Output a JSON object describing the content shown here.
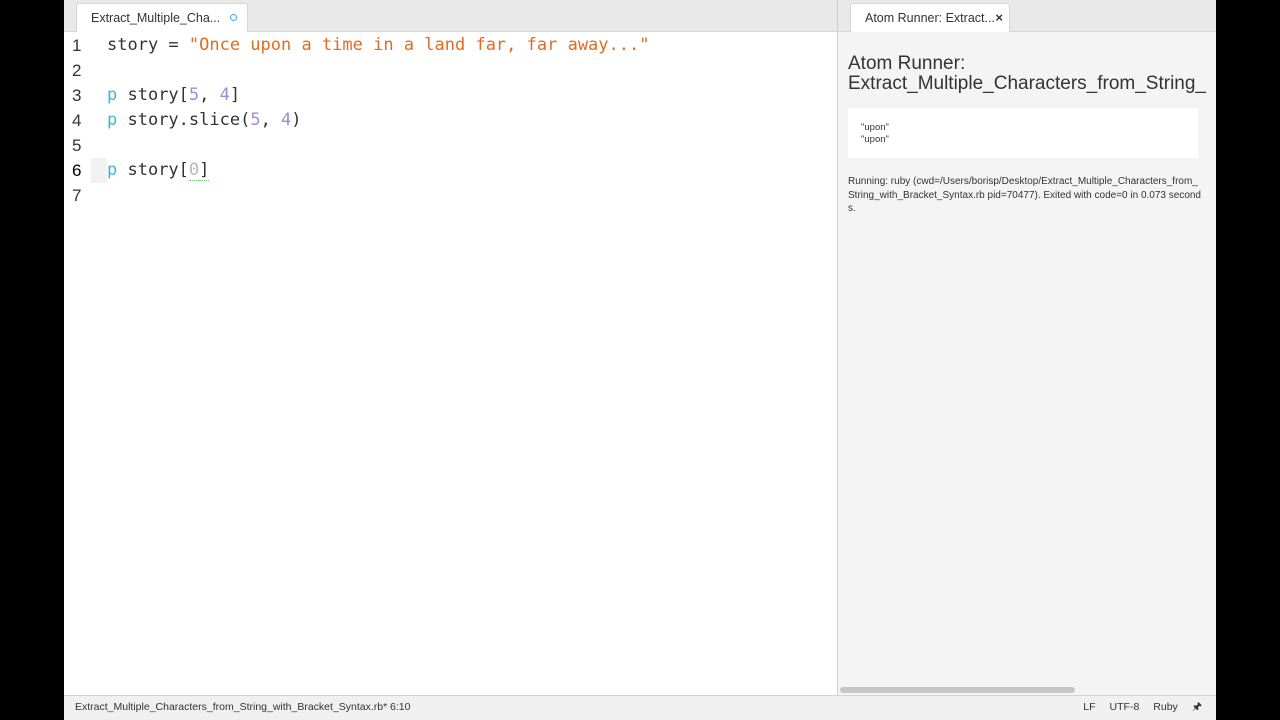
{
  "editor": {
    "tab_label": "Extract_Multiple_Cha...",
    "lines": [
      {
        "num": "1",
        "tokens": [
          {
            "t": "story = ",
            "c": "ident"
          },
          {
            "t": "\"Once upon a time in a land far, far away...\"",
            "c": "string"
          }
        ]
      },
      {
        "num": "2",
        "tokens": []
      },
      {
        "num": "3",
        "tokens": [
          {
            "t": "p",
            "c": "keyword"
          },
          {
            "t": " story[",
            "c": "ident"
          },
          {
            "t": "5",
            "c": "number"
          },
          {
            "t": ", ",
            "c": "ident"
          },
          {
            "t": "4",
            "c": "number"
          },
          {
            "t": "]",
            "c": "ident"
          }
        ]
      },
      {
        "num": "4",
        "tokens": [
          {
            "t": "p",
            "c": "keyword"
          },
          {
            "t": " story.slice(",
            "c": "ident"
          },
          {
            "t": "5",
            "c": "number"
          },
          {
            "t": ", ",
            "c": "ident"
          },
          {
            "t": "4",
            "c": "number"
          },
          {
            "t": ")",
            "c": "ident"
          }
        ]
      },
      {
        "num": "5",
        "tokens": []
      },
      {
        "num": "6",
        "tokens": [
          {
            "t": "p",
            "c": "keyword"
          },
          {
            "t": " story[",
            "c": "ident"
          },
          {
            "t": "0",
            "c": "cursor-num"
          },
          {
            "t": "]",
            "c": "bracket-dim"
          }
        ]
      },
      {
        "num": "7",
        "tokens": []
      }
    ],
    "cursor_line": "6"
  },
  "runner": {
    "tab_label": "Atom Runner: Extract...",
    "title_line1": "Atom Runner:",
    "title_line2": "Extract_Multiple_Characters_from_String_",
    "output": [
      "\"upon\"",
      "\"upon\""
    ],
    "status": "Running: ruby (cwd=/Users/borisp/Desktop/Extract_Multiple_Characters_from_String_with_Bracket_Syntax.rb pid=70477). Exited with code=0 in 0.073 seconds."
  },
  "statusbar": {
    "file": "Extract_Multiple_Characters_from_String_with_Bracket_Syntax.rb*",
    "position": "6:10",
    "line_ending": "LF",
    "encoding": "UTF-8",
    "grammar": "Ruby",
    "pin_icon": "pin-icon"
  },
  "colors": {
    "string": "#e06c1f",
    "number": "#a28ad6",
    "keyword": "#3bb5d8",
    "modified_dot": "#41a7e8"
  }
}
